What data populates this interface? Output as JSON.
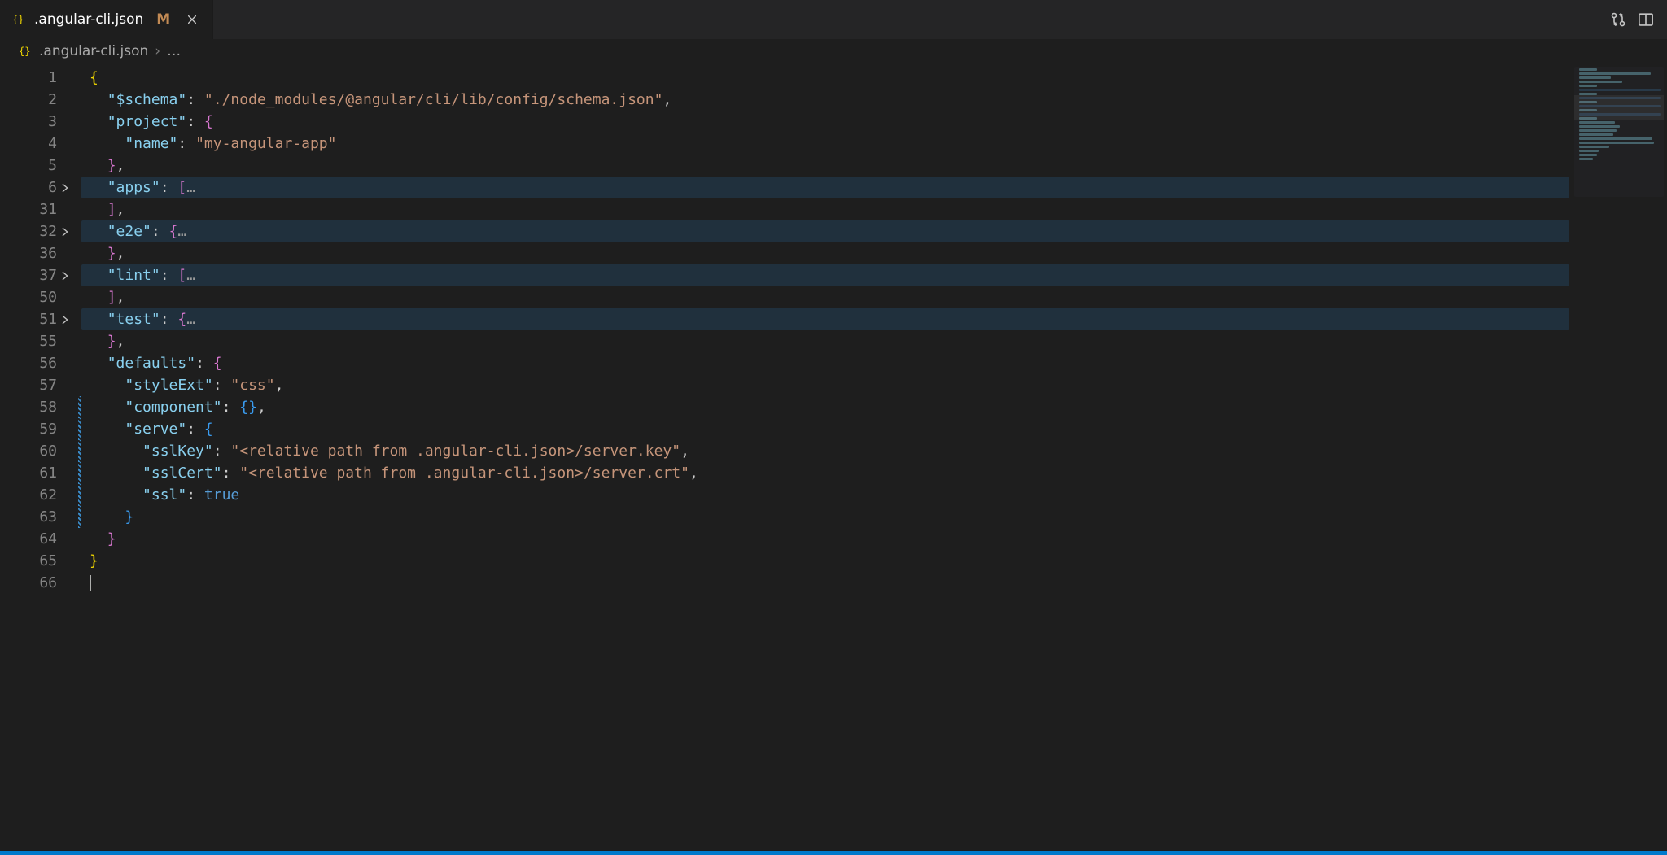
{
  "tab": {
    "filename": ".angular-cli.json",
    "modified_marker": "M"
  },
  "breadcrumbs": {
    "filename": ".angular-cli.json",
    "more": "…"
  },
  "lines": [
    {
      "num": "1",
      "fold": false,
      "diff": false,
      "hi": false,
      "tokens": [
        [
          "p-y",
          "{"
        ]
      ]
    },
    {
      "num": "2",
      "fold": false,
      "diff": false,
      "hi": false,
      "tokens": [
        [
          "pun",
          "  "
        ],
        [
          "key",
          "\"$schema\""
        ],
        [
          "pun",
          ": "
        ],
        [
          "str",
          "\"./node_modules/@angular/cli/lib/config/schema.json\""
        ],
        [
          "pun",
          ","
        ]
      ]
    },
    {
      "num": "3",
      "fold": false,
      "diff": false,
      "hi": false,
      "tokens": [
        [
          "pun",
          "  "
        ],
        [
          "key",
          "\"project\""
        ],
        [
          "pun",
          ": "
        ],
        [
          "p-p",
          "{"
        ]
      ]
    },
    {
      "num": "4",
      "fold": false,
      "diff": false,
      "hi": false,
      "tokens": [
        [
          "pun",
          "    "
        ],
        [
          "key",
          "\"name\""
        ],
        [
          "pun",
          ": "
        ],
        [
          "str",
          "\"my-angular-app\""
        ]
      ]
    },
    {
      "num": "5",
      "fold": false,
      "diff": false,
      "hi": false,
      "tokens": [
        [
          "pun",
          "  "
        ],
        [
          "p-p",
          "}"
        ],
        [
          "pun",
          ","
        ]
      ]
    },
    {
      "num": "6",
      "fold": true,
      "diff": false,
      "hi": true,
      "tokens": [
        [
          "pun",
          "  "
        ],
        [
          "key",
          "\"apps\""
        ],
        [
          "pun",
          ": "
        ],
        [
          "p-p",
          "["
        ],
        [
          "ell",
          "…"
        ]
      ]
    },
    {
      "num": "31",
      "fold": false,
      "diff": false,
      "hi": false,
      "tokens": [
        [
          "pun",
          "  "
        ],
        [
          "p-p",
          "]"
        ],
        [
          "pun",
          ","
        ]
      ]
    },
    {
      "num": "32",
      "fold": true,
      "diff": false,
      "hi": true,
      "tokens": [
        [
          "pun",
          "  "
        ],
        [
          "key",
          "\"e2e\""
        ],
        [
          "pun",
          ": "
        ],
        [
          "p-p",
          "{"
        ],
        [
          "ell",
          "…"
        ]
      ]
    },
    {
      "num": "36",
      "fold": false,
      "diff": false,
      "hi": false,
      "tokens": [
        [
          "pun",
          "  "
        ],
        [
          "p-p",
          "}"
        ],
        [
          "pun",
          ","
        ]
      ]
    },
    {
      "num": "37",
      "fold": true,
      "diff": false,
      "hi": true,
      "tokens": [
        [
          "pun",
          "  "
        ],
        [
          "key",
          "\"lint\""
        ],
        [
          "pun",
          ": "
        ],
        [
          "p-p",
          "["
        ],
        [
          "ell",
          "…"
        ]
      ]
    },
    {
      "num": "50",
      "fold": false,
      "diff": false,
      "hi": false,
      "tokens": [
        [
          "pun",
          "  "
        ],
        [
          "p-p",
          "]"
        ],
        [
          "pun",
          ","
        ]
      ]
    },
    {
      "num": "51",
      "fold": true,
      "diff": false,
      "hi": true,
      "tokens": [
        [
          "pun",
          "  "
        ],
        [
          "key",
          "\"test\""
        ],
        [
          "pun",
          ": "
        ],
        [
          "p-p",
          "{"
        ],
        [
          "ell",
          "…"
        ]
      ]
    },
    {
      "num": "55",
      "fold": false,
      "diff": false,
      "hi": false,
      "tokens": [
        [
          "pun",
          "  "
        ],
        [
          "p-p",
          "}"
        ],
        [
          "pun",
          ","
        ]
      ]
    },
    {
      "num": "56",
      "fold": false,
      "diff": false,
      "hi": false,
      "tokens": [
        [
          "pun",
          "  "
        ],
        [
          "key",
          "\"defaults\""
        ],
        [
          "pun",
          ": "
        ],
        [
          "p-p",
          "{"
        ]
      ]
    },
    {
      "num": "57",
      "fold": false,
      "diff": false,
      "hi": false,
      "tokens": [
        [
          "pun",
          "    "
        ],
        [
          "key",
          "\"styleExt\""
        ],
        [
          "pun",
          ": "
        ],
        [
          "str",
          "\"css\""
        ],
        [
          "pun",
          ","
        ]
      ]
    },
    {
      "num": "58",
      "fold": false,
      "diff": true,
      "hi": false,
      "tokens": [
        [
          "pun",
          "    "
        ],
        [
          "key",
          "\"component\""
        ],
        [
          "pun",
          ": "
        ],
        [
          "p-b",
          "{}"
        ],
        [
          "pun",
          ","
        ]
      ]
    },
    {
      "num": "59",
      "fold": false,
      "diff": true,
      "hi": false,
      "tokens": [
        [
          "pun",
          "    "
        ],
        [
          "key",
          "\"serve\""
        ],
        [
          "pun",
          ": "
        ],
        [
          "p-b",
          "{"
        ]
      ]
    },
    {
      "num": "60",
      "fold": false,
      "diff": true,
      "hi": false,
      "tokens": [
        [
          "pun",
          "      "
        ],
        [
          "key",
          "\"sslKey\""
        ],
        [
          "pun",
          ": "
        ],
        [
          "str",
          "\"<relative path from .angular-cli.json>/server.key\""
        ],
        [
          "pun",
          ","
        ]
      ]
    },
    {
      "num": "61",
      "fold": false,
      "diff": true,
      "hi": false,
      "tokens": [
        [
          "pun",
          "      "
        ],
        [
          "key",
          "\"sslCert\""
        ],
        [
          "pun",
          ": "
        ],
        [
          "str",
          "\"<relative path from .angular-cli.json>/server.crt\""
        ],
        [
          "pun",
          ","
        ]
      ]
    },
    {
      "num": "62",
      "fold": false,
      "diff": true,
      "hi": false,
      "tokens": [
        [
          "pun",
          "      "
        ],
        [
          "key",
          "\"ssl\""
        ],
        [
          "pun",
          ": "
        ],
        [
          "kw",
          "true"
        ]
      ]
    },
    {
      "num": "63",
      "fold": false,
      "diff": true,
      "hi": false,
      "tokens": [
        [
          "pun",
          "    "
        ],
        [
          "p-b",
          "}"
        ]
      ]
    },
    {
      "num": "64",
      "fold": false,
      "diff": false,
      "hi": false,
      "tokens": [
        [
          "pun",
          "  "
        ],
        [
          "p-p",
          "}"
        ]
      ]
    },
    {
      "num": "65",
      "fold": false,
      "diff": false,
      "hi": false,
      "tokens": [
        [
          "p-y",
          "}"
        ]
      ]
    },
    {
      "num": "66",
      "fold": false,
      "diff": false,
      "hi": false,
      "caret": true,
      "tokens": []
    }
  ]
}
